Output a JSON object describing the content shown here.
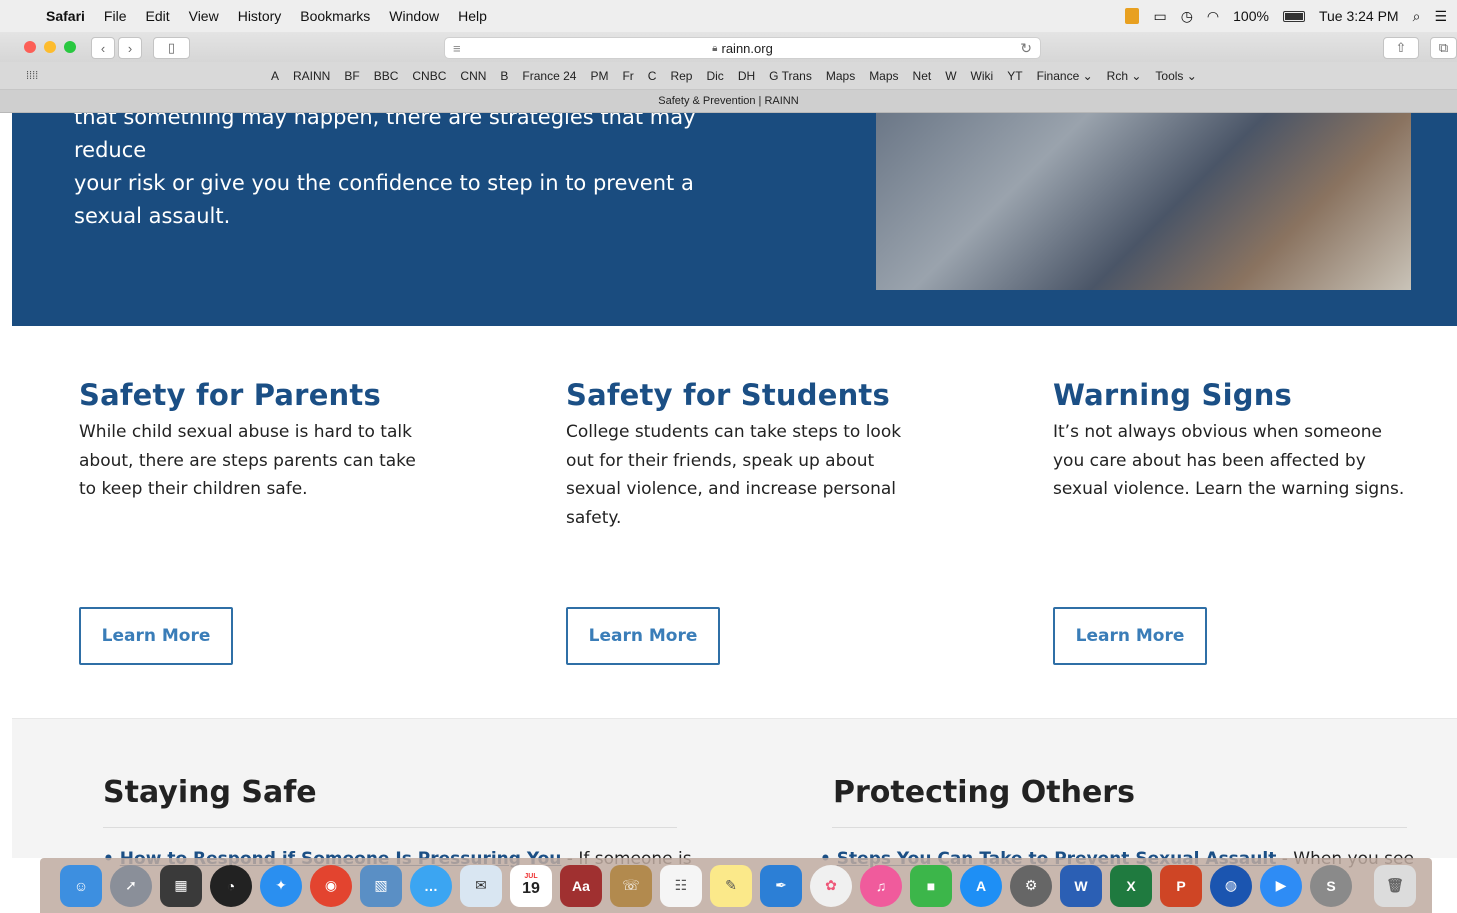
{
  "menubar": {
    "apple": "",
    "app": "Safari",
    "items": [
      "File",
      "Edit",
      "View",
      "History",
      "Bookmarks",
      "Window",
      "Help"
    ],
    "battery": "100%",
    "clock": "Tue 3:24 PM"
  },
  "toolbar": {
    "url": "rainn.org"
  },
  "favorites": [
    "A",
    "RAINN",
    "BF",
    "BBC",
    "CNBC",
    "CNN",
    "B",
    "France 24",
    "PM",
    "Fr",
    "C",
    "Rep",
    "Dic",
    "DH",
    "G Trans",
    "Maps",
    "Maps",
    "Net",
    "W",
    "Wiki",
    "YT",
    "Finance ⌄",
    "Rch ⌄",
    "Tools ⌄"
  ],
  "tab": {
    "title": "Safety & Prevention | RAINN"
  },
  "hero": {
    "line1": "that something may happen, there are strategies that may reduce",
    "line2": "your risk or give you the confidence to step in to prevent a",
    "line3": "sexual assault."
  },
  "cards": [
    {
      "title": "Safety for Parents",
      "body": "While child sexual abuse is hard to talk about, there are steps parents can take to keep their children safe.",
      "button": "Learn More"
    },
    {
      "title": "Safety for Students",
      "body": "College students can take steps to look out for their friends, speak up about sexual violence, and increase personal safety.",
      "button": "Learn More"
    },
    {
      "title": "Warning Signs",
      "body": "It’s not always obvious when someone you care about has been affected by sexual violence. Learn the warning signs.",
      "button": "Learn More"
    }
  ],
  "lower": {
    "left_title": "Staying Safe",
    "left_link": "How to Respond if Someone Is Pressuring You",
    "left_text": " - If someone is",
    "right_title": "Protecting Others",
    "right_link": "Steps You Can Take to Prevent Sexual Assault",
    "right_text": " - When you see"
  },
  "dock": {
    "calendar_day": "19",
    "calendar_month": "JUL",
    "dictionary": "Aa"
  },
  "colors": {
    "hero_bg": "#1a4c7f",
    "heading_blue": "#1b4f85",
    "button_blue": "#3a7db8"
  }
}
